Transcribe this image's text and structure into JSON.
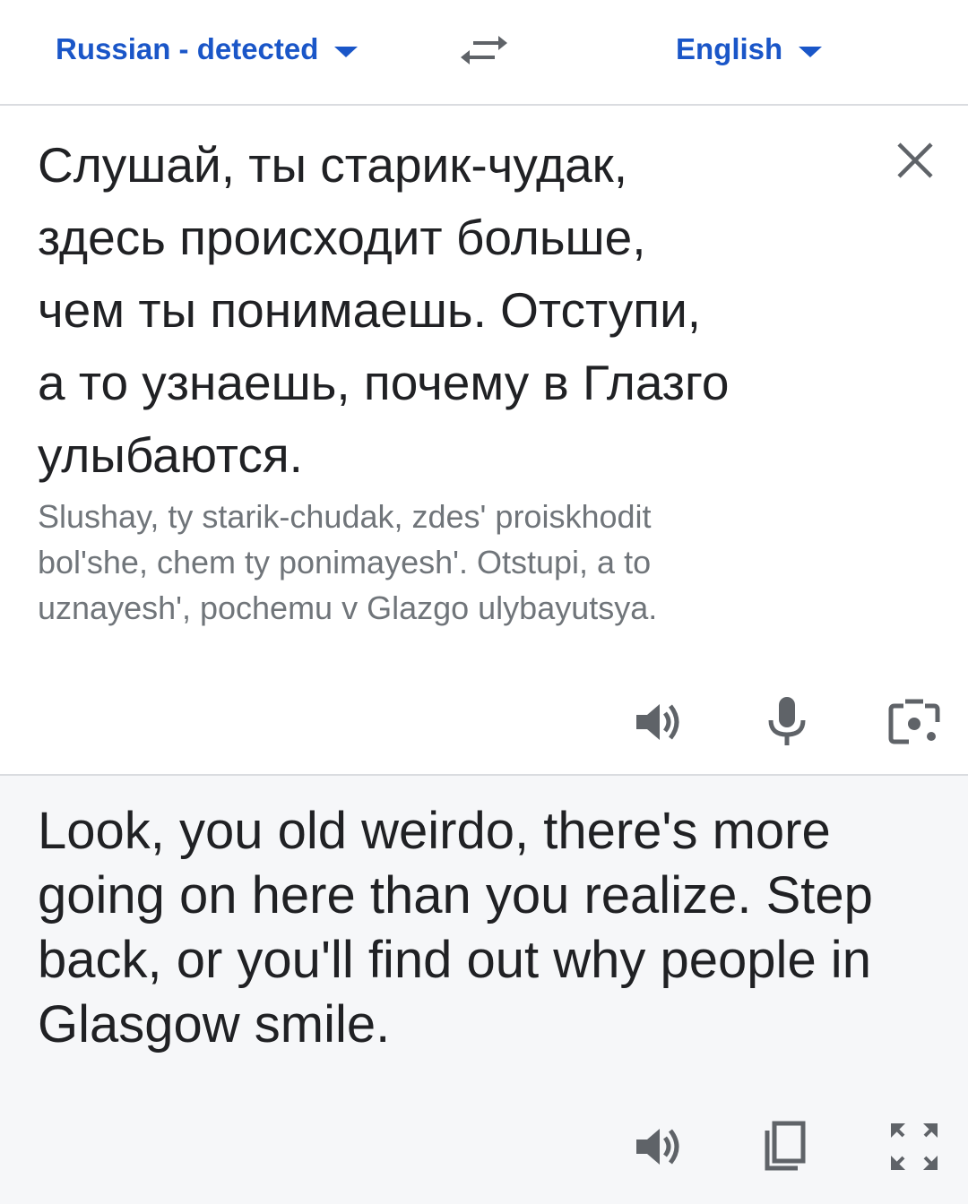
{
  "language_bar": {
    "source_language": "Russian - detected",
    "target_language": "English"
  },
  "source": {
    "text": "Слушай, ты старик-чудак,\nздесь происходит больше,\nчем ты понимаешь. Отступи,\nа то узнаешь, почему в Глазго\nулыбаются.",
    "transliteration": "Slushay, ty starik-chudak, zdes' proiskhodit\nbol'she, chem ty ponimayesh'. Otstupi, a to\nuznayesh', pochemu v Glazgo ulybayutsya."
  },
  "result": {
    "text": "Look, you old weirdo, there's more\ngoing on here than you realize. Step\nback, or you'll find out why people in\nGlasgow smile."
  },
  "icons": {
    "swap": "swap-languages-icon",
    "close": "close-icon",
    "speaker": "speaker-icon",
    "mic": "microphone-icon",
    "camera": "camera-lens-icon",
    "copy": "copy-icon",
    "fullscreen": "fullscreen-icon"
  },
  "colors": {
    "accent": "#1a56c8",
    "text": "#202124",
    "secondary_text": "#70757a",
    "icon": "#5f6368",
    "result_background": "#f6f7f9",
    "divider": "#dadce0"
  }
}
